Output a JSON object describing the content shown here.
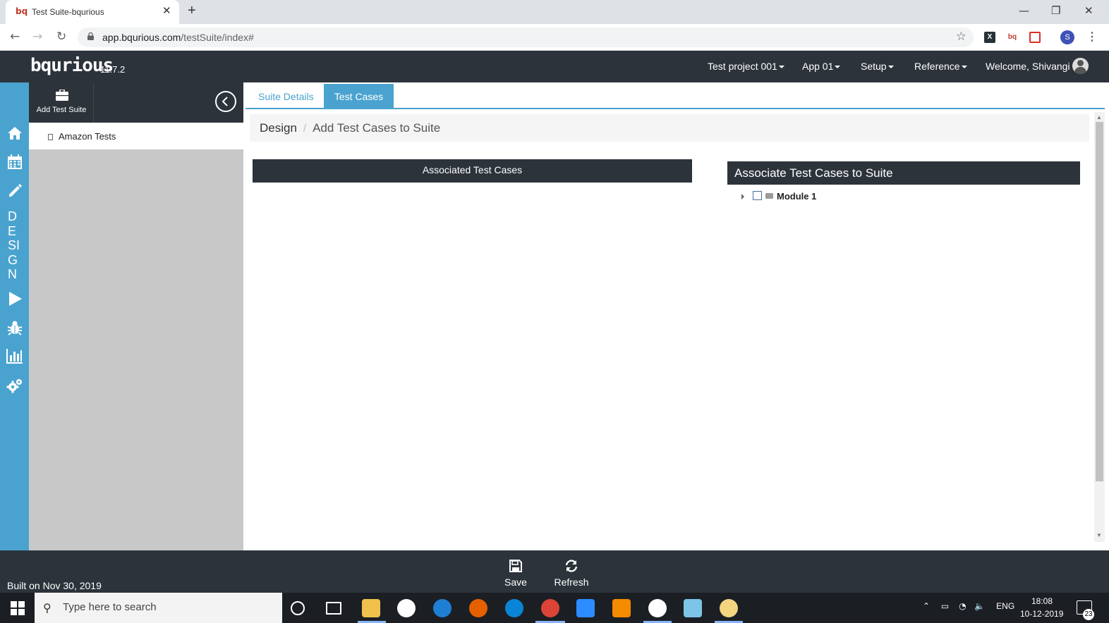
{
  "browser": {
    "tab_title": "Test Suite-bqurious",
    "favicon_text": "bq",
    "url_host": "app.bqurious.com",
    "url_path": "/testSuite/index#",
    "profile_initial": "S"
  },
  "header": {
    "logo": "bqurious",
    "version": "11.7.2",
    "nav": [
      "Test project 001",
      "App 01",
      "Setup",
      "Reference"
    ],
    "welcome": "Welcome, Shivangi"
  },
  "rail": {
    "design_letters": [
      "D",
      "E",
      "SI",
      "G",
      "N"
    ],
    "icons": [
      "home-icon",
      "calendar-icon",
      "pencil-icon",
      "play-icon",
      "bug-icon",
      "bar-chart-icon",
      "gears-icon"
    ]
  },
  "sidebar": {
    "add_suite_label": "Add Test Suite",
    "suites": [
      "Amazon Tests"
    ]
  },
  "main": {
    "tabs": [
      "Suite Details",
      "Test Cases"
    ],
    "active_tab": "Test Cases",
    "breadcrumb": [
      "Design",
      "Add Test Cases to Suite"
    ],
    "associated_header": "Associated Test Cases",
    "available_header": "Associate Test Cases to Suite",
    "tree": [
      {
        "label": "Module 1",
        "checked": false,
        "expanded": false
      }
    ]
  },
  "footer": {
    "built_on": "Built on Nov 30, 2019",
    "save_label": "Save",
    "refresh_label": "Refresh"
  },
  "taskbar": {
    "search_placeholder": "Type here to search",
    "language": "ENG",
    "time": "18:08",
    "date": "10-12-2019",
    "notification_count": "23"
  },
  "colors": {
    "accent": "#4aa3cf",
    "dark": "#2c333b",
    "sidebar_gray": "#c8c8c8"
  }
}
